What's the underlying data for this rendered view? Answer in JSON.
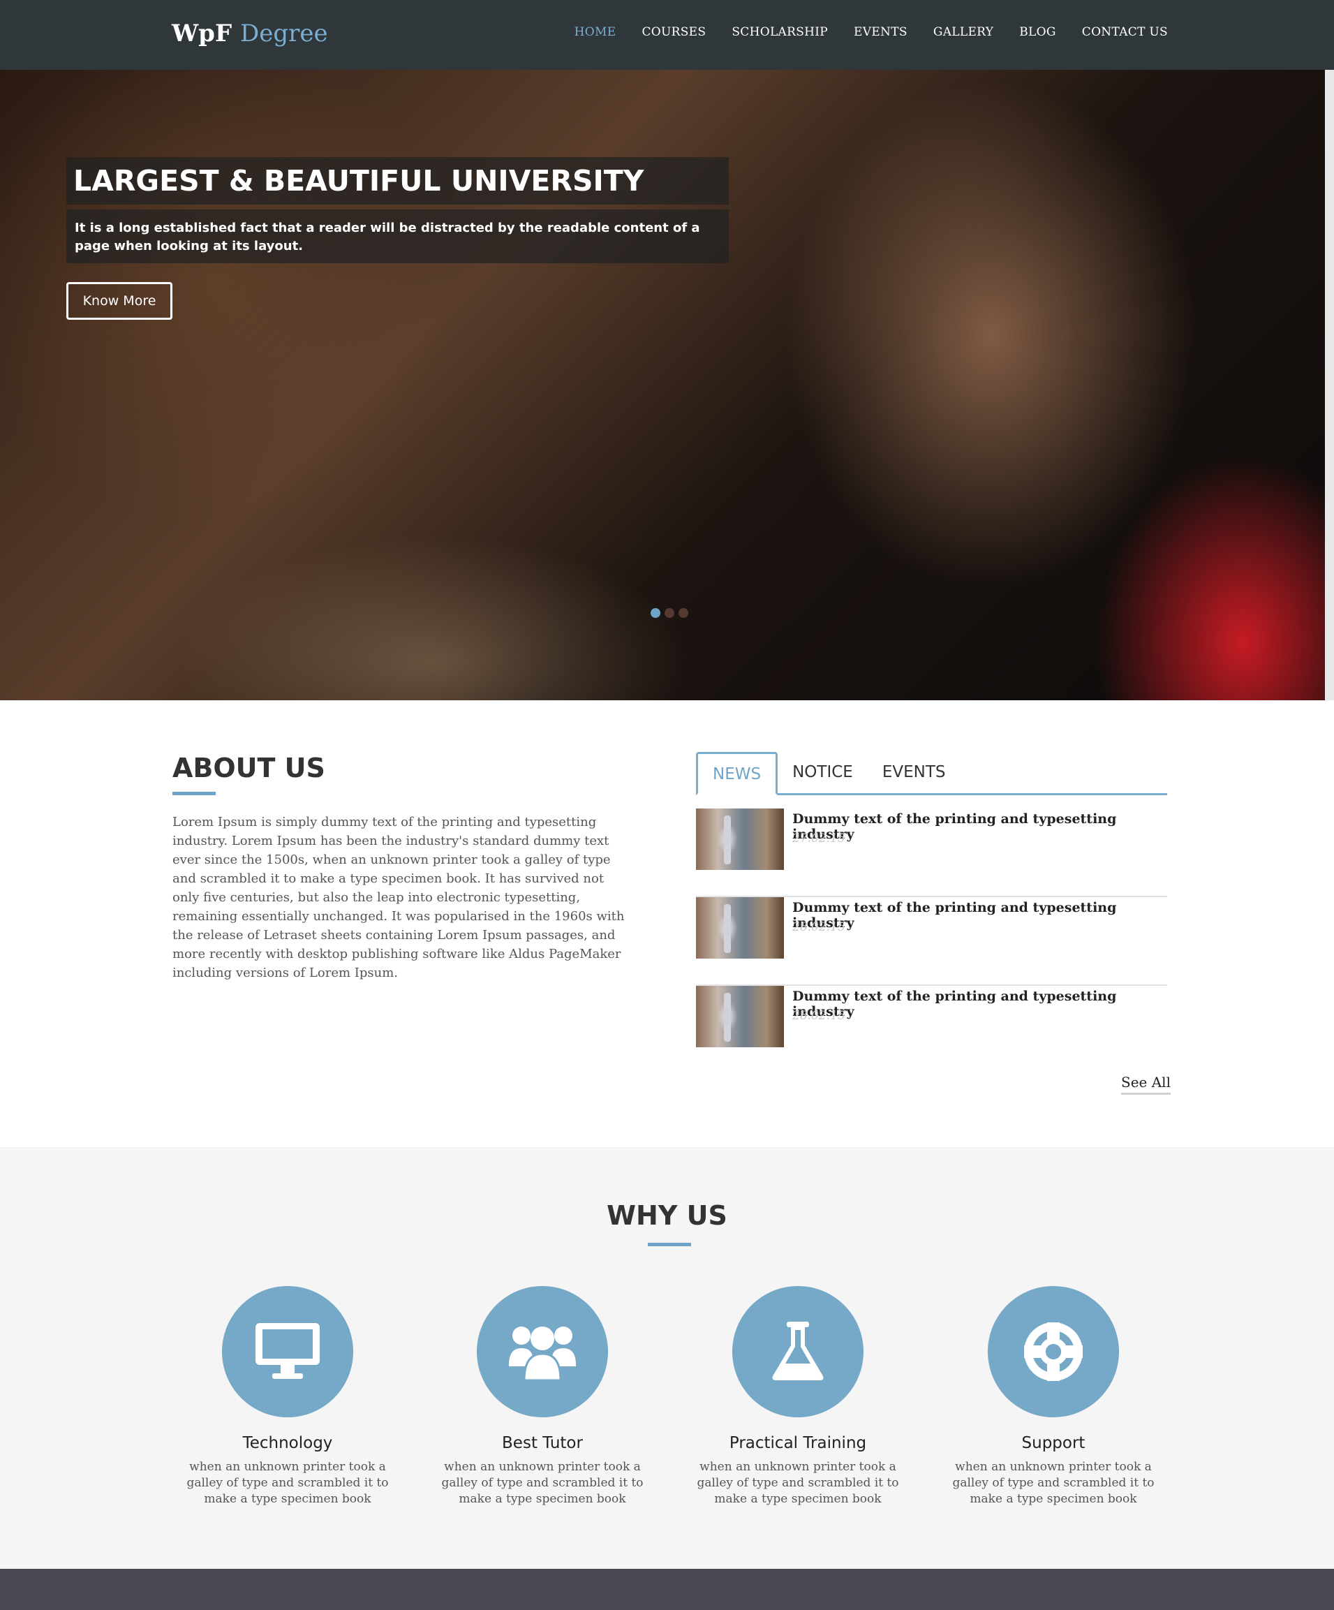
{
  "header": {
    "logo_main": "WpF",
    "logo_accent": "Degree",
    "nav": [
      "HOME",
      "COURSES",
      "SCHOLARSHIP",
      "EVENTS",
      "GALLERY",
      "BLOG",
      "CONTACT US"
    ]
  },
  "hero": {
    "title": "LARGEST & BEAUTIFUL UNIVERSITY",
    "description": "It is a long established fact that a reader will be distracted by the readable content of a page when looking at its layout.",
    "button": "Know More"
  },
  "about": {
    "title": "ABOUT US",
    "text": "Lorem Ipsum is simply dummy text of the printing and typesetting industry. Lorem Ipsum has been the industry's standard dummy text ever since the 1500s, when an unknown printer took a galley of type and scrambled it to make a type specimen book. It has survived not only five centuries, but also the leap into electronic typesetting, remaining essentially unchanged. It was popularised in the 1960s with the release of Letraset sheets containing Lorem Ipsum passages, and more recently with desktop publishing software like Aldus PageMaker including versions of Lorem Ipsum."
  },
  "tabs": [
    "NEWS",
    "NOTICE",
    "EVENTS"
  ],
  "news": [
    {
      "title": "Dummy text of the printing and typesetting industry",
      "date": "27.02.15"
    },
    {
      "title": "Dummy text of the printing and typesetting industry",
      "date": "28.02.15"
    },
    {
      "title": "Dummy text of the printing and typesetting industry",
      "date": "28.02.15"
    }
  ],
  "see_all": "See All",
  "why": {
    "title": "WHY US",
    "features": [
      {
        "icon": "monitor-icon",
        "title": "Technology",
        "text": "when an unknown printer took a galley of type and scrambled it to make a type specimen book"
      },
      {
        "icon": "group-icon",
        "title": "Best Tutor",
        "text": "when an unknown printer took a galley of type and scrambled it to make a type specimen book"
      },
      {
        "icon": "flask-icon",
        "title": "Practical Training",
        "text": "when an unknown printer took a galley of type and scrambled it to make a type specimen book"
      },
      {
        "icon": "lifebuoy-icon",
        "title": "Support",
        "text": "when an unknown printer took a galley of type and scrambled it to make a type specimen book"
      }
    ]
  },
  "colors": {
    "header_bg": "#2f373b",
    "accent": "#7aafd1",
    "why_bg": "#f5f5f5",
    "footer_bg": "#4a4a55"
  }
}
